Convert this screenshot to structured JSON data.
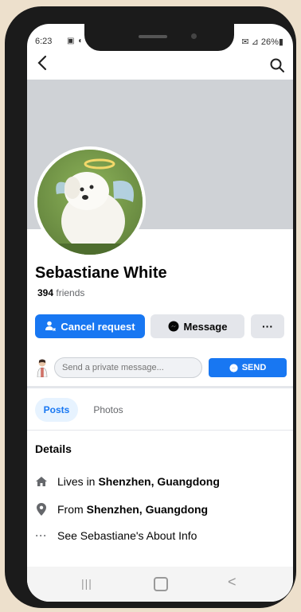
{
  "status_bar": {
    "time": "6:23",
    "left_icons": "▣ ◐ ■",
    "right_text": "✉ ⊿ 26%▮"
  },
  "top_bar": {
    "back_icon": "chevron-left-icon",
    "search_icon": "search-icon"
  },
  "profile": {
    "name": "Sebastiane White",
    "friends_count": "394",
    "friends_label": "friends"
  },
  "actions": {
    "cancel_request": "Cancel request",
    "message": "Message",
    "more": "···"
  },
  "private_message": {
    "placeholder": "Send a private message...",
    "send_label": "SEND"
  },
  "tabs": [
    {
      "label": "Posts",
      "active": true
    },
    {
      "label": "Photos",
      "active": false
    }
  ],
  "details": {
    "title": "Details",
    "lives_prefix": "Lives in",
    "lives_place": "Shenzhen, Guangdong",
    "from_prefix": "From",
    "from_place": "Shenzhen, Guangdong",
    "about_link": "See Sebastiane's About Info"
  },
  "nav_bar": {
    "recents": "|||",
    "back": "<"
  },
  "colors": {
    "accent": "#1877f2",
    "cover": "#cfd2d6",
    "secondary_button": "#e4e6eb",
    "phone_frame": "#1b1b1b",
    "background": "#ede0cc"
  }
}
